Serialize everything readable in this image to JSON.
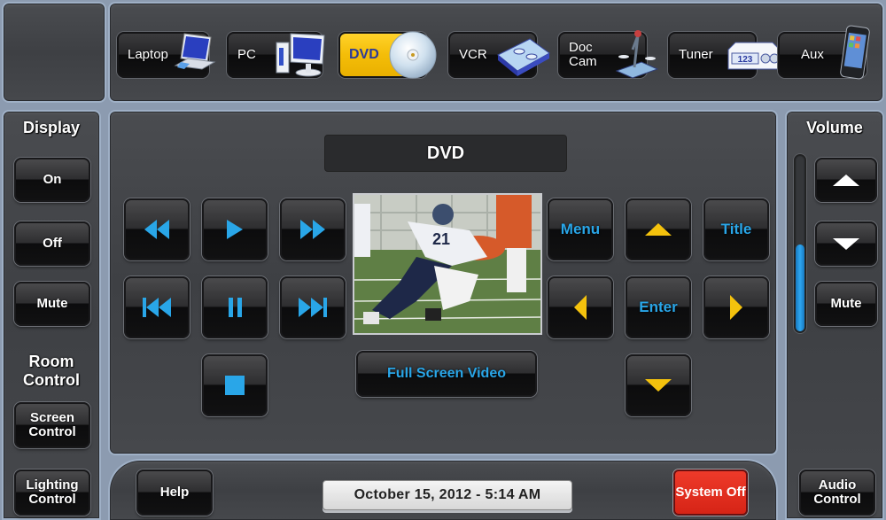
{
  "sources": [
    {
      "label": "Laptop",
      "icon": "laptop-icon",
      "active": false
    },
    {
      "label": "PC",
      "icon": "desktop-pc-icon",
      "active": false
    },
    {
      "label": "DVD",
      "icon": "disc-icon",
      "active": true
    },
    {
      "label": "VCR",
      "icon": "vhs-tape-icon",
      "active": false
    },
    {
      "label": "Doc Cam",
      "icon": "document-camera-icon",
      "active": false
    },
    {
      "label": "Tuner",
      "icon": "tuner-icon",
      "active": false
    },
    {
      "label": "Aux",
      "icon": "phone-icon",
      "active": false
    }
  ],
  "tuner_display": "123",
  "display": {
    "title": "Display",
    "on": "On",
    "off": "Off",
    "mute": "Mute"
  },
  "room_control": {
    "title": "Room Control",
    "screen": "Screen Control",
    "lighting": "Lighting Control"
  },
  "main": {
    "source_title": "DVD",
    "full_screen": "Full Screen Video",
    "menu": "Menu",
    "title": "Title",
    "enter": "Enter",
    "transport": [
      "rewind",
      "play",
      "fast-forward",
      "previous-chapter",
      "pause",
      "next-chapter",
      "stop"
    ]
  },
  "volume": {
    "title": "Volume",
    "level_percent": 50,
    "mute": "Mute"
  },
  "bottom": {
    "help": "Help",
    "datetime": "October 15, 2012  -  5:14 AM",
    "system_off": "System Off",
    "audio_control": "Audio Control"
  },
  "colors": {
    "accent_blue": "#29a6e8",
    "nav_yellow": "#f4c20d",
    "active_source": "#f4bd08",
    "system_off_red": "#d62416"
  }
}
